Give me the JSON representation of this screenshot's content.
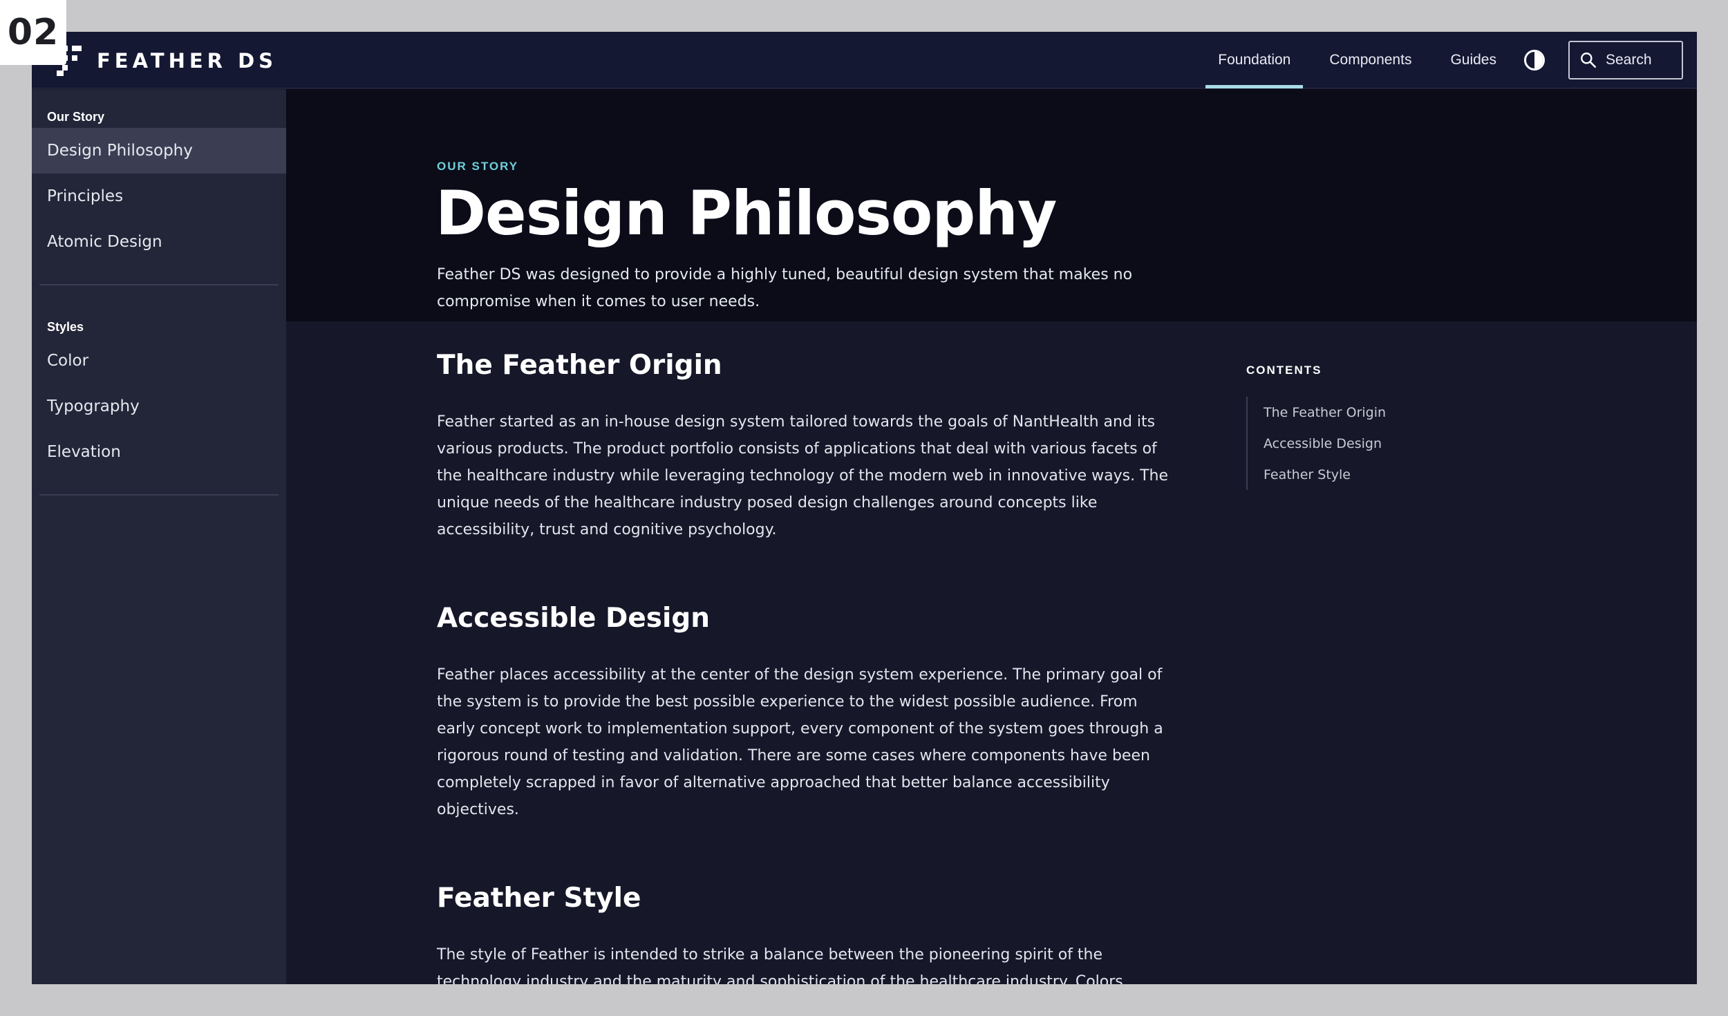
{
  "badge": "02",
  "brand": {
    "name": "FEATHER DS"
  },
  "nav": {
    "links": [
      "Foundation",
      "Components",
      "Guides"
    ],
    "active": "Foundation",
    "search_label": "Search",
    "accent_color": "#a9dce8"
  },
  "sidebar": {
    "groups": [
      {
        "title": "Our Story",
        "items": [
          "Design Philosophy",
          "Principles",
          "Atomic Design"
        ]
      },
      {
        "title": "Styles",
        "items": [
          "Color",
          "Typography",
          "Elevation"
        ]
      }
    ],
    "active_item": "Design Philosophy"
  },
  "hero": {
    "eyebrow": "OUR STORY",
    "title": "Design Philosophy",
    "subtitle": "Feather DS was designed to provide a highly tuned, beautiful design system that makes no compromise when it comes to user needs."
  },
  "sections": [
    {
      "heading": "The Feather Origin",
      "body": "Feather started as an in-house design system tailored towards the goals of NantHealth and its various products. The product portfolio consists of applications that deal with various facets of the healthcare industry while leveraging technology of the modern web in innovative ways. The unique needs of the healthcare industry posed design challenges around concepts like accessibility, trust and cognitive psychology."
    },
    {
      "heading": "Accessible Design",
      "body": "Feather places accessibility at the center of the design system experience. The primary goal of the system is to provide the best possible experience to the widest possible audience. From early concept work to implementation support, every component of the system goes through a rigorous round of testing and validation. There are some cases where components have been completely scrapped in favor of alternative approached that better balance accessibility objectives."
    },
    {
      "heading": "Feather Style",
      "body": "The style of Feather is intended to strike a balance between the pioneering spirit of the technology industry and the maturity and sophistication of the healthcare industry. Colors,"
    }
  ],
  "toc": {
    "title": "CONTENTS",
    "items": [
      "The Feather Origin",
      "Accessible Design",
      "Feather Style"
    ]
  }
}
